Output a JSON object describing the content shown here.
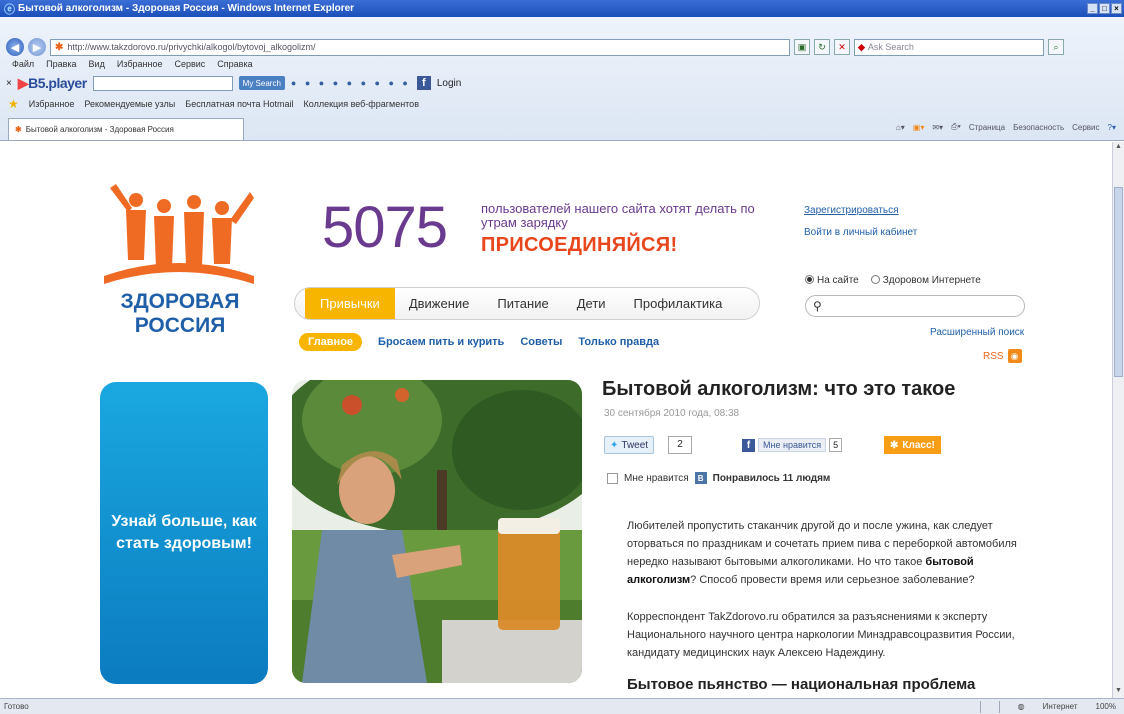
{
  "window": {
    "title": "Бытовой алкоголизм - Здоровая Россия - Windows Internet Explorer",
    "controls": [
      "_",
      "□",
      "×"
    ]
  },
  "address": {
    "url": "http://www.takzdorovo.ru/privychki/alkogol/bytovoj_alkogolizm/",
    "search_placeholder": "Ask Search"
  },
  "menu": [
    "Файл",
    "Правка",
    "Вид",
    "Избранное",
    "Сервис",
    "Справка"
  ],
  "toolbar": {
    "b5_label": "B5.player",
    "search_pill": "My Search",
    "fb_label": "Login"
  },
  "favorites": {
    "label": "Избранное",
    "links": [
      "Рекомендуемые узлы",
      "Бесплатная почта Hotmail",
      "Коллекция веб-фрагментов"
    ]
  },
  "tab": {
    "title": "Бытовой алкоголизм - Здоровая Россия"
  },
  "commands": [
    "Страница",
    "Безопасность",
    "Сервис"
  ],
  "site": {
    "logo_line1": "ЗДОРОВАЯ",
    "logo_line2": "РОССИЯ",
    "counter": "5075",
    "counter_text": "пользователей нашего сайта хотят делать по утрам зарядку",
    "join": "ПРИСОЕДИНЯЙСЯ!",
    "register": "Зарегистрироваться",
    "cabinet": "Войти в личный кабинет",
    "radio_site": "На сайте",
    "radio_web": "Здоровом Интернете",
    "adv_search": "Расширенный поиск",
    "rss": "RSS"
  },
  "nav": {
    "main": [
      "Привычки",
      "Движение",
      "Питание",
      "Дети",
      "Профилактика"
    ],
    "sub": [
      "Главное",
      "Бросаем пить и курить",
      "Советы",
      "Только правда"
    ]
  },
  "banner": {
    "text": "Узнай больше, как стать здоровым!"
  },
  "article": {
    "title": "Бытовой алкоголизм: что это такое",
    "date": "30 сентября 2010 года, 08:38",
    "tweet": "Tweet",
    "tweet_count": "2",
    "like_label": "Мне нравится",
    "like_count": "5",
    "klass": "Класс!",
    "vk_label": "Мне нравится",
    "vk_count": "Понравилось 11 людям",
    "para1_a": "Любителей пропустить стаканчик другой до и после ужина, как следует оторваться по праздникам и сочетать прием пива с переборкой автомобиля нередко называют бытовыми алкоголиками. Но что такое ",
    "para1_b": "бытовой алкоголизм",
    "para1_c": "? Способ провести время или серьезное заболевание?",
    "para2": "Корреспондент TakZdorovo.ru обратился за разъяснениями к эксперту Национального научного центра наркологии Минздравсоцразвития России, кандидату медицинских наук Алексею Надеждину.",
    "h2": "Бытовое пьянство — национальная проблема"
  },
  "status": {
    "left": "Готово",
    "zone": "Интернет",
    "zoom": "100%"
  },
  "colors": {
    "accent": "#f8b500",
    "brand_blue": "#1f5fa8",
    "orange": "#e8461c",
    "purple": "#6a3a8f"
  }
}
